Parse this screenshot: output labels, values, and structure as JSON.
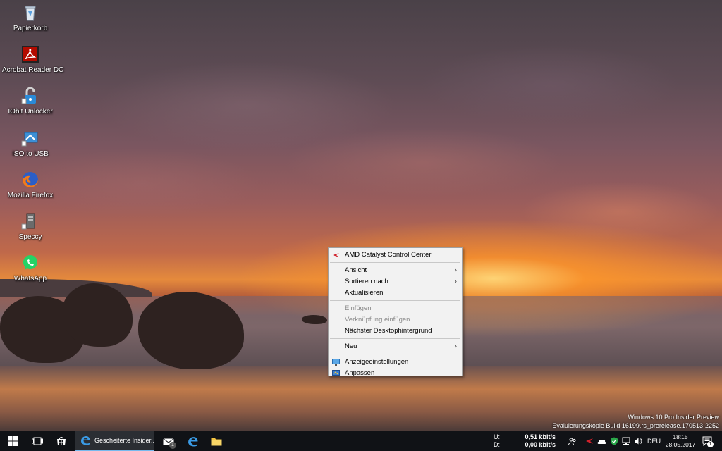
{
  "desktop": {
    "icons": [
      {
        "label": "Papierkorb",
        "icon": "recycle-bin-icon"
      },
      {
        "label": "Acrobat Reader DC",
        "icon": "acrobat-reader-icon"
      },
      {
        "label": "IObit Unlocker",
        "icon": "iobit-unlocker-icon"
      },
      {
        "label": "ISO to USB",
        "icon": "iso-to-usb-icon"
      },
      {
        "label": "Mozilla Firefox",
        "icon": "firefox-icon"
      },
      {
        "label": "Speccy",
        "icon": "speccy-icon"
      },
      {
        "label": "WhatsApp",
        "icon": "whatsapp-icon"
      }
    ]
  },
  "context_menu": {
    "items": [
      {
        "label": "AMD Catalyst Control Center",
        "icon": "amd-catalyst-icon"
      },
      {
        "label": "Ansicht",
        "submenu": true
      },
      {
        "label": "Sortieren nach",
        "submenu": true
      },
      {
        "label": "Aktualisieren"
      },
      {
        "label": "Einfügen",
        "disabled": true
      },
      {
        "label": "Verknüpfung einfügen",
        "disabled": true
      },
      {
        "label": "Nächster Desktophintergrund"
      },
      {
        "label": "Neu",
        "submenu": true
      },
      {
        "label": "Anzeigeeinstellungen",
        "icon": "display-settings-icon"
      },
      {
        "label": "Anpassen",
        "icon": "personalize-icon"
      }
    ],
    "submenu_arrow": "›"
  },
  "watermark": {
    "line1": "Windows 10 Pro Insider Preview",
    "line2": "Evaluierungskopie Build 16199.rs_prerelease.170513-2252"
  },
  "taskbar": {
    "active_task_label": "Gescheiterte Insider...",
    "mail_badge": "1",
    "network": {
      "up_label": "U:",
      "down_label": "D:",
      "up_value": "0,51 kbit/s",
      "down_value": "0,00 kbit/s"
    },
    "language": "DEU",
    "time": "18:15",
    "date": "28.05.2017",
    "notification_badge": "1"
  },
  "colors": {
    "accent": "#76b9ed",
    "taskbar": "#101216",
    "menu_bg": "#f2f2f2"
  }
}
